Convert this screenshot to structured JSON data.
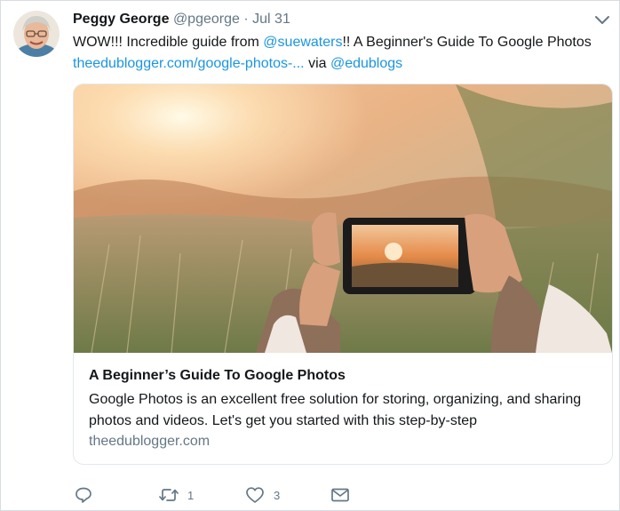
{
  "tweet": {
    "display_name": "Peggy George",
    "handle": "@pgeorge",
    "separator": "·",
    "date": "Jul 31",
    "text_part1": "WOW!!! Incredible guide from ",
    "mention1": "@suewaters",
    "text_part2": "!! A Beginner's Guide To Google Photos ",
    "link": "theedublogger.com/google-photos-...",
    "text_part3": " via ",
    "mention2": "@edublogs"
  },
  "card": {
    "title": "A Beginner’s Guide To Google Photos",
    "description": "Google Photos is an excellent free solution for storing, organizing, and sharing photos and videos. Let's get you started with this step-by-step",
    "domain": "theedublogger.com"
  },
  "actions": {
    "reply_icon": "reply-icon",
    "retweet_icon": "retweet-icon",
    "retweet_count": "1",
    "like_icon": "heart-icon",
    "like_count": "3",
    "dm_icon": "envelope-icon"
  },
  "colors": {
    "link": "#1b95e0",
    "secondary_text": "#657786",
    "primary_text": "#14171a",
    "border": "#e1e8ed"
  }
}
